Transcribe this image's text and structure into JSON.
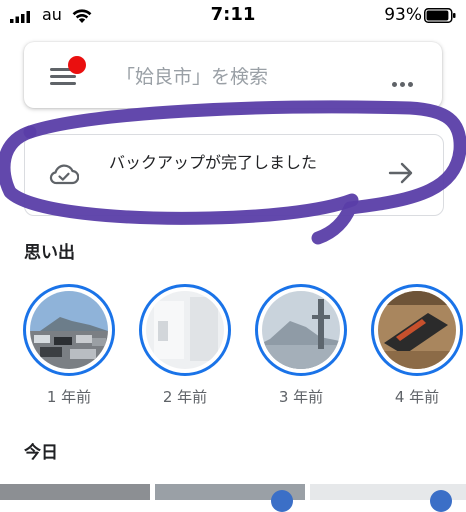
{
  "status_bar": {
    "carrier": "au",
    "time": "7:11",
    "battery_percent": "93%",
    "battery_level": 0.93
  },
  "search": {
    "placeholder": "「姶良市」を検索",
    "has_notification": true,
    "notification_color": "#ea0f0f"
  },
  "backup": {
    "message": "バックアップが完了しました",
    "icon": "cloud-done-icon"
  },
  "memories": {
    "title": "思い出",
    "items": [
      {
        "label": "1 年前",
        "icon": "memory-thumbnail"
      },
      {
        "label": "2 年前",
        "icon": "memory-thumbnail"
      },
      {
        "label": "3 年前",
        "icon": "memory-thumbnail"
      },
      {
        "label": "4 年前",
        "icon": "memory-thumbnail"
      }
    ],
    "ring_color": "#1a73e8"
  },
  "today": {
    "title": "今日"
  },
  "annotation_color": "#5a3ea8"
}
